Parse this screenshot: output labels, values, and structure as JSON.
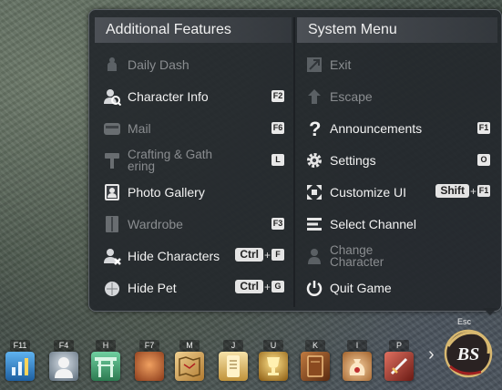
{
  "left_column": {
    "title": "Additional Features",
    "items": [
      {
        "label": "Daily Dash",
        "icon": "daily-dash-icon",
        "enabled": false,
        "key": ""
      },
      {
        "label": "Character Info",
        "icon": "character-info-icon",
        "enabled": true,
        "key": "F2"
      },
      {
        "label": "Mail",
        "icon": "mail-icon",
        "enabled": false,
        "key": "F6"
      },
      {
        "label": "Crafting & Gath ering",
        "icon": "crafting-icon",
        "enabled": false,
        "key": "L"
      },
      {
        "label": "Photo Gallery",
        "icon": "photo-gallery-icon",
        "enabled": true,
        "key": ""
      },
      {
        "label": "Wardrobe",
        "icon": "wardrobe-icon",
        "enabled": false,
        "key": "F3"
      },
      {
        "label": "Hide Characters",
        "icon": "hide-characters-icon",
        "enabled": true,
        "combo_mod": "Ctrl",
        "combo_plus": "+",
        "combo_key": "F"
      },
      {
        "label": "Hide Pet",
        "icon": "hide-pet-icon",
        "enabled": true,
        "combo_mod": "Ctrl",
        "combo_plus": "+",
        "combo_key": "G"
      }
    ]
  },
  "right_column": {
    "title": "System Menu",
    "items": [
      {
        "label": "Exit",
        "icon": "exit-icon",
        "enabled": false,
        "key": ""
      },
      {
        "label": "Escape",
        "icon": "escape-icon",
        "enabled": false,
        "key": ""
      },
      {
        "label": "Announcements",
        "icon": "question-icon",
        "enabled": true,
        "key": "F1"
      },
      {
        "label": "Settings",
        "icon": "gear-icon",
        "enabled": true,
        "key": "O"
      },
      {
        "label": "Customize UI",
        "icon": "customize-ui-icon",
        "enabled": true,
        "combo_mod": "Shift",
        "combo_plus": "+",
        "combo_key": "F1"
      },
      {
        "label": "Select Channel",
        "icon": "channel-icon",
        "enabled": true,
        "key": ""
      },
      {
        "label": "Change Character",
        "icon": "change-character-icon",
        "enabled": false,
        "key": ""
      },
      {
        "label": "Quit Game",
        "icon": "power-icon",
        "enabled": true,
        "key": ""
      }
    ]
  },
  "hotbar": {
    "slots": [
      {
        "key": "F11",
        "icon": "stats-icon",
        "color": "#3a8fd6"
      },
      {
        "key": "F4",
        "icon": "character-bust-icon",
        "color": "#8a9aa8"
      },
      {
        "key": "H",
        "icon": "gate-icon",
        "color": "#3d9a6a"
      },
      {
        "key": "F7",
        "icon": "pouch-icon",
        "color": "#c2703a"
      },
      {
        "key": "M",
        "icon": "map-icon",
        "color": "#c9a256"
      },
      {
        "key": "J",
        "icon": "scroll-icon",
        "color": "#d8b56b"
      },
      {
        "key": "U",
        "icon": "trophy-icon",
        "color": "#c9962f"
      },
      {
        "key": "K",
        "icon": "book-icon",
        "color": "#9a5b2d"
      },
      {
        "key": "I",
        "icon": "bag-icon",
        "color": "#d8aa72"
      },
      {
        "key": "P",
        "icon": "sword-icon",
        "color": "#b2473a"
      }
    ],
    "expand_arrow": "›",
    "esc_key": "Esc",
    "logo_text": "BS"
  },
  "colors": {
    "panel_bg": "#24282d",
    "text_enabled": "#f2f2f2",
    "text_disabled": "#8a8d90",
    "key_badge": "#e8e8e8"
  }
}
